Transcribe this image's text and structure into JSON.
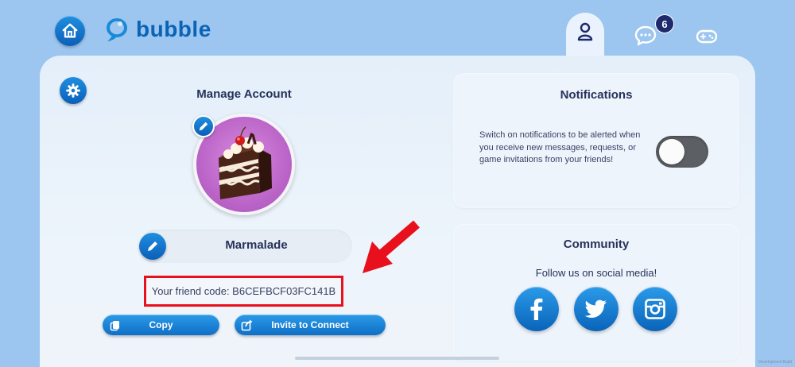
{
  "header": {
    "logo_text": "bubble",
    "notification_count": "6"
  },
  "account": {
    "title": "Manage Account",
    "username": "Marmalade",
    "friend_code_label": "Your friend code: B6CEFBCF03FC141B",
    "copy_label": "Copy",
    "invite_label": "Invite to Connect",
    "avatar_icon": "cake-slice"
  },
  "notifications": {
    "title": "Notifications",
    "description": "Switch on notifications to be alerted when you receive new messages, requests, or game invitations from your friends!",
    "enabled": false
  },
  "community": {
    "title": "Community",
    "subtitle": "Follow us on social media!",
    "networks": [
      "facebook-icon",
      "twitter-icon",
      "instagram-icon"
    ]
  },
  "footer": {
    "watermark": "Development Build"
  },
  "colors": {
    "background": "#9cc6ef",
    "accent": "#0f6fc6",
    "highlight_border": "#e8101c",
    "title_text": "#26325a"
  }
}
